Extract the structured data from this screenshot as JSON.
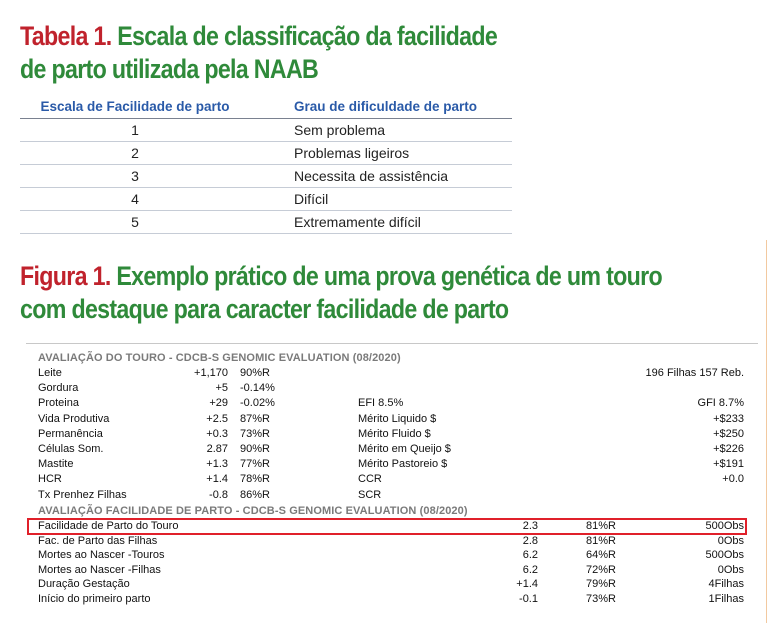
{
  "table1": {
    "heading_label": "Tabela 1.",
    "heading_line1": "Escala de classificação da facilidade",
    "heading_line2": "de parto utilizada pela NAAB",
    "columns": [
      "Escala de Facilidade de parto",
      "Grau de dificuldade de parto"
    ],
    "rows": [
      [
        "1",
        "Sem problema"
      ],
      [
        "2",
        "Problemas ligeiros"
      ],
      [
        "3",
        "Necessita de assistência"
      ],
      [
        "4",
        "Difícil"
      ],
      [
        "5",
        "Extremamente difícil"
      ]
    ]
  },
  "figure1": {
    "heading_label": "Figura 1.",
    "heading_line1": "Exemplo prático de uma prova genética de um touro",
    "heading_line2": "com destaque para caracter facilidade de parto",
    "section1_title": "AVALIAÇÃO DO TOURO  - CDCB-S GENOMIC EVALUATION  (08/2020)",
    "section1_rows": [
      [
        "Leite",
        "+1,170",
        "90%R",
        "",
        "196 Filhas 157 Reb."
      ],
      [
        "Gordura",
        "+5",
        "-0.14%",
        "",
        ""
      ],
      [
        "Proteina",
        "+29",
        "-0.02%",
        "EFI 8.5%",
        "GFI 8.7%"
      ],
      [
        "Vida Produtiva",
        "+2.5",
        "87%R",
        "Mérito Liquido $",
        "+$233"
      ],
      [
        "Permanência",
        "+0.3",
        "73%R",
        "Mérito Fluido $",
        "+$250"
      ],
      [
        "Células Som.",
        "2.87",
        "90%R",
        "Mérito em Queijo $",
        "+$226"
      ],
      [
        "Mastite",
        "+1.3",
        "77%R",
        "Mérito Pastoreio $",
        "+$191"
      ],
      [
        "HCR",
        "+1.4",
        "78%R",
        "CCR",
        "+0.0"
      ],
      [
        "Tx Prenhez Filhas",
        "-0.8",
        "86%R",
        "SCR",
        ""
      ]
    ],
    "section2_title": "AVALIAÇÃO FACILIDADE DE PARTO  - CDCB-S GENOMIC EVALUATION  (08/2020)",
    "section2_rows": [
      [
        "Facilidade de Parto do Touro",
        "2.3",
        "81%R",
        "500Obs"
      ],
      [
        "Fac. de Parto das Filhas",
        "2.8",
        "81%R",
        "0Obs"
      ],
      [
        "Mortes ao Nascer -Touros",
        "6.2",
        "64%R",
        "500Obs"
      ],
      [
        "Mortes ao Nascer -Filhas",
        "6.2",
        "72%R",
        "0Obs"
      ],
      [
        "Duração Gestação",
        "+1.4",
        "79%R",
        "4Filhas"
      ],
      [
        "Início do primeiro parto",
        "-0.1",
        "73%R",
        "1Filhas"
      ]
    ],
    "highlight_color": "#e0202a"
  }
}
